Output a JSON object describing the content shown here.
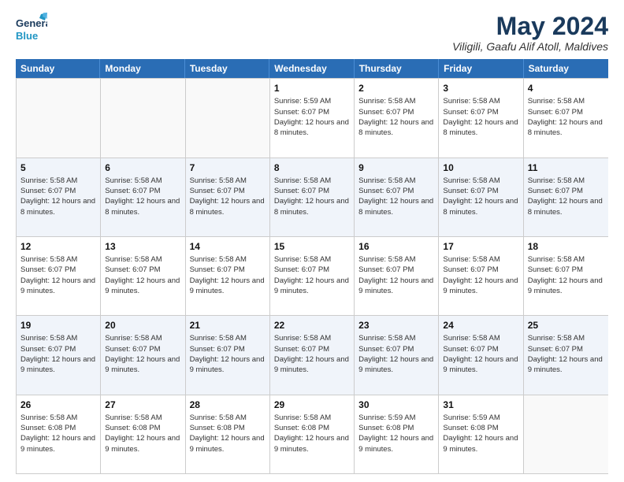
{
  "logo": {
    "line1": "General",
    "line2": "Blue"
  },
  "title": "May 2024",
  "location": "Viligili, Gaafu Alif Atoll, Maldives",
  "days_of_week": [
    "Sunday",
    "Monday",
    "Tuesday",
    "Wednesday",
    "Thursday",
    "Friday",
    "Saturday"
  ],
  "weeks": [
    [
      {
        "day": "",
        "sunrise": "",
        "sunset": "",
        "daylight": "",
        "empty": true
      },
      {
        "day": "",
        "sunrise": "",
        "sunset": "",
        "daylight": "",
        "empty": true
      },
      {
        "day": "",
        "sunrise": "",
        "sunset": "",
        "daylight": "",
        "empty": true
      },
      {
        "day": "1",
        "sunrise": "Sunrise: 5:59 AM",
        "sunset": "Sunset: 6:07 PM",
        "daylight": "Daylight: 12 hours and 8 minutes."
      },
      {
        "day": "2",
        "sunrise": "Sunrise: 5:58 AM",
        "sunset": "Sunset: 6:07 PM",
        "daylight": "Daylight: 12 hours and 8 minutes."
      },
      {
        "day": "3",
        "sunrise": "Sunrise: 5:58 AM",
        "sunset": "Sunset: 6:07 PM",
        "daylight": "Daylight: 12 hours and 8 minutes."
      },
      {
        "day": "4",
        "sunrise": "Sunrise: 5:58 AM",
        "sunset": "Sunset: 6:07 PM",
        "daylight": "Daylight: 12 hours and 8 minutes."
      }
    ],
    [
      {
        "day": "5",
        "sunrise": "Sunrise: 5:58 AM",
        "sunset": "Sunset: 6:07 PM",
        "daylight": "Daylight: 12 hours and 8 minutes."
      },
      {
        "day": "6",
        "sunrise": "Sunrise: 5:58 AM",
        "sunset": "Sunset: 6:07 PM",
        "daylight": "Daylight: 12 hours and 8 minutes."
      },
      {
        "day": "7",
        "sunrise": "Sunrise: 5:58 AM",
        "sunset": "Sunset: 6:07 PM",
        "daylight": "Daylight: 12 hours and 8 minutes."
      },
      {
        "day": "8",
        "sunrise": "Sunrise: 5:58 AM",
        "sunset": "Sunset: 6:07 PM",
        "daylight": "Daylight: 12 hours and 8 minutes."
      },
      {
        "day": "9",
        "sunrise": "Sunrise: 5:58 AM",
        "sunset": "Sunset: 6:07 PM",
        "daylight": "Daylight: 12 hours and 8 minutes."
      },
      {
        "day": "10",
        "sunrise": "Sunrise: 5:58 AM",
        "sunset": "Sunset: 6:07 PM",
        "daylight": "Daylight: 12 hours and 8 minutes."
      },
      {
        "day": "11",
        "sunrise": "Sunrise: 5:58 AM",
        "sunset": "Sunset: 6:07 PM",
        "daylight": "Daylight: 12 hours and 8 minutes."
      }
    ],
    [
      {
        "day": "12",
        "sunrise": "Sunrise: 5:58 AM",
        "sunset": "Sunset: 6:07 PM",
        "daylight": "Daylight: 12 hours and 9 minutes."
      },
      {
        "day": "13",
        "sunrise": "Sunrise: 5:58 AM",
        "sunset": "Sunset: 6:07 PM",
        "daylight": "Daylight: 12 hours and 9 minutes."
      },
      {
        "day": "14",
        "sunrise": "Sunrise: 5:58 AM",
        "sunset": "Sunset: 6:07 PM",
        "daylight": "Daylight: 12 hours and 9 minutes."
      },
      {
        "day": "15",
        "sunrise": "Sunrise: 5:58 AM",
        "sunset": "Sunset: 6:07 PM",
        "daylight": "Daylight: 12 hours and 9 minutes."
      },
      {
        "day": "16",
        "sunrise": "Sunrise: 5:58 AM",
        "sunset": "Sunset: 6:07 PM",
        "daylight": "Daylight: 12 hours and 9 minutes."
      },
      {
        "day": "17",
        "sunrise": "Sunrise: 5:58 AM",
        "sunset": "Sunset: 6:07 PM",
        "daylight": "Daylight: 12 hours and 9 minutes."
      },
      {
        "day": "18",
        "sunrise": "Sunrise: 5:58 AM",
        "sunset": "Sunset: 6:07 PM",
        "daylight": "Daylight: 12 hours and 9 minutes."
      }
    ],
    [
      {
        "day": "19",
        "sunrise": "Sunrise: 5:58 AM",
        "sunset": "Sunset: 6:07 PM",
        "daylight": "Daylight: 12 hours and 9 minutes."
      },
      {
        "day": "20",
        "sunrise": "Sunrise: 5:58 AM",
        "sunset": "Sunset: 6:07 PM",
        "daylight": "Daylight: 12 hours and 9 minutes."
      },
      {
        "day": "21",
        "sunrise": "Sunrise: 5:58 AM",
        "sunset": "Sunset: 6:07 PM",
        "daylight": "Daylight: 12 hours and 9 minutes."
      },
      {
        "day": "22",
        "sunrise": "Sunrise: 5:58 AM",
        "sunset": "Sunset: 6:07 PM",
        "daylight": "Daylight: 12 hours and 9 minutes."
      },
      {
        "day": "23",
        "sunrise": "Sunrise: 5:58 AM",
        "sunset": "Sunset: 6:07 PM",
        "daylight": "Daylight: 12 hours and 9 minutes."
      },
      {
        "day": "24",
        "sunrise": "Sunrise: 5:58 AM",
        "sunset": "Sunset: 6:07 PM",
        "daylight": "Daylight: 12 hours and 9 minutes."
      },
      {
        "day": "25",
        "sunrise": "Sunrise: 5:58 AM",
        "sunset": "Sunset: 6:07 PM",
        "daylight": "Daylight: 12 hours and 9 minutes."
      }
    ],
    [
      {
        "day": "26",
        "sunrise": "Sunrise: 5:58 AM",
        "sunset": "Sunset: 6:08 PM",
        "daylight": "Daylight: 12 hours and 9 minutes."
      },
      {
        "day": "27",
        "sunrise": "Sunrise: 5:58 AM",
        "sunset": "Sunset: 6:08 PM",
        "daylight": "Daylight: 12 hours and 9 minutes."
      },
      {
        "day": "28",
        "sunrise": "Sunrise: 5:58 AM",
        "sunset": "Sunset: 6:08 PM",
        "daylight": "Daylight: 12 hours and 9 minutes."
      },
      {
        "day": "29",
        "sunrise": "Sunrise: 5:58 AM",
        "sunset": "Sunset: 6:08 PM",
        "daylight": "Daylight: 12 hours and 9 minutes."
      },
      {
        "day": "30",
        "sunrise": "Sunrise: 5:59 AM",
        "sunset": "Sunset: 6:08 PM",
        "daylight": "Daylight: 12 hours and 9 minutes."
      },
      {
        "day": "31",
        "sunrise": "Sunrise: 5:59 AM",
        "sunset": "Sunset: 6:08 PM",
        "daylight": "Daylight: 12 hours and 9 minutes."
      },
      {
        "day": "",
        "sunrise": "",
        "sunset": "",
        "daylight": "",
        "empty": true
      }
    ]
  ]
}
